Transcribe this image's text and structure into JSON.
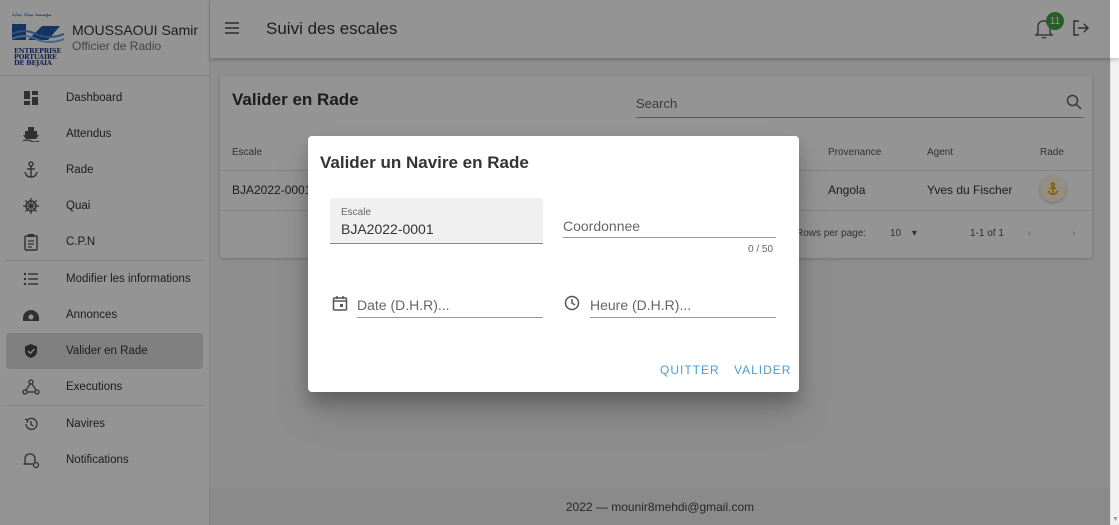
{
  "profile": {
    "logo_top_text": "مؤسسة ميناء بجاية",
    "logo_lines": [
      "ENTREPRISE",
      "PORTUAIRE",
      "DE BEJAIA"
    ],
    "name": "MOUSSAOUI Samir",
    "role": "Officier de Radio"
  },
  "sidebar": {
    "items": [
      {
        "label": "Dashboard",
        "icon": "dashboard-icon"
      },
      {
        "label": "Attendus",
        "icon": "ship-icon"
      },
      {
        "label": "Rade",
        "icon": "anchor-icon"
      },
      {
        "label": "Quai",
        "icon": "helm-icon"
      },
      {
        "label": "C.P.N",
        "icon": "clipboard-icon"
      },
      {
        "label": "Modifier les informations",
        "icon": "list-icon"
      },
      {
        "label": "Annonces",
        "icon": "announce-icon"
      },
      {
        "label": "Valider en Rade",
        "icon": "shield-check-icon"
      },
      {
        "label": "Executions",
        "icon": "hub-icon"
      },
      {
        "label": "Navires",
        "icon": "history-icon"
      },
      {
        "label": "Notifications",
        "icon": "bell-settings-icon"
      }
    ],
    "active": "Valider en Rade"
  },
  "topbar": {
    "title": "Suivi des escales",
    "notification_count": "11"
  },
  "card": {
    "title": "Valider en Rade",
    "search_placeholder": "Search",
    "headers": [
      "Escale",
      "Provenance",
      "Agent",
      "Rade"
    ],
    "row": {
      "escale": "BJA2022-0001",
      "provenance": "Angola",
      "agent": "Yves du Fischer"
    },
    "pagination": {
      "rows_label": "Rows per page:",
      "rows_value": "10",
      "range": "1-1 of 1"
    }
  },
  "dialog": {
    "title": "Valider un Navire en Rade",
    "escale_label": "Escale",
    "escale_value": "BJA2022-0001",
    "coord_placeholder": "Coordonnee",
    "coord_counter": "0 / 50",
    "date_placeholder": "Date (D.H.R)...",
    "time_placeholder": "Heure (D.H.R)...",
    "cancel_label": "QUITTER",
    "confirm_label": "VALIDER"
  },
  "footer": {
    "text": "2022 — mounir8mehdi@gmail.com"
  },
  "colors": {
    "accent": "#4a9dd9",
    "badge": "#43a047",
    "rade_icon": "#f2a100"
  }
}
